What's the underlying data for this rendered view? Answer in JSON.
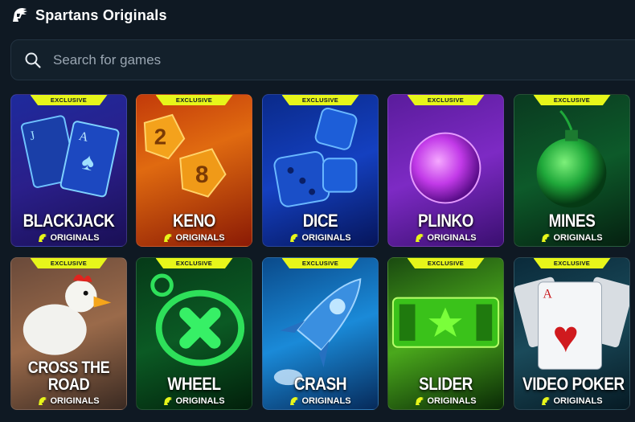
{
  "header": {
    "title": "Spartans Originals"
  },
  "search": {
    "placeholder": "Search for games"
  },
  "badge_label": "EXCLUSIVE",
  "sub_label": "ORIGINALS",
  "accent_color": "#e7f61a",
  "games": [
    {
      "name": "BLACKJACK"
    },
    {
      "name": "KENO"
    },
    {
      "name": "DICE"
    },
    {
      "name": "PLINKO"
    },
    {
      "name": "MINES"
    },
    {
      "name": "CROSS THE ROAD",
      "line1": "CROSS THE",
      "line2": "ROAD"
    },
    {
      "name": "WHEEL"
    },
    {
      "name": "CRASH"
    },
    {
      "name": "SLIDER"
    },
    {
      "name": "VIDEO POKER"
    }
  ]
}
